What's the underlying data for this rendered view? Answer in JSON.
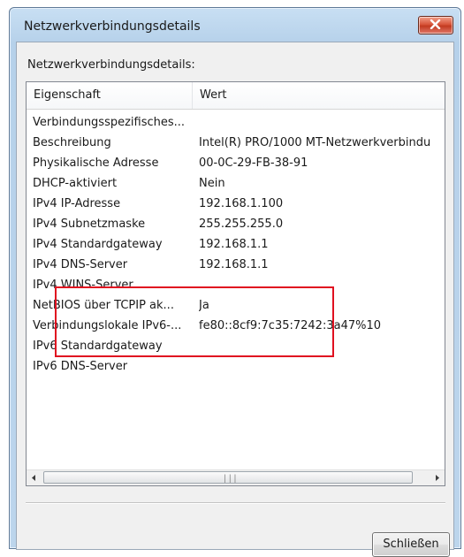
{
  "window": {
    "title": "Netzwerkverbindungsdetails"
  },
  "group_label": "Netzwerkverbindungsdetails:",
  "columns": {
    "property": "Eigenschaft",
    "value": "Wert"
  },
  "rows": [
    {
      "property": "Verbindungsspezifisches...",
      "value": ""
    },
    {
      "property": "Beschreibung",
      "value": "Intel(R) PRO/1000 MT-Netzwerkverbindu"
    },
    {
      "property": "Physikalische Adresse",
      "value": "00-0C-29-FB-38-91"
    },
    {
      "property": "DHCP-aktiviert",
      "value": "Nein"
    },
    {
      "property": "IPv4 IP-Adresse",
      "value": "192.168.1.100"
    },
    {
      "property": "IPv4 Subnetzmaske",
      "value": "255.255.255.0"
    },
    {
      "property": "IPv4 Standardgateway",
      "value": "192.168.1.1"
    },
    {
      "property": "IPv4 DNS-Server",
      "value": "192.168.1.1"
    },
    {
      "property": "IPv4 WINS-Server",
      "value": ""
    },
    {
      "property": "NetBIOS über TCPIP ak...",
      "value": "Ja"
    },
    {
      "property": "Verbindungslokale IPv6-...",
      "value": "fe80::8cf9:7c35:7242:3a47%10"
    },
    {
      "property": "IPv6 Standardgateway",
      "value": ""
    },
    {
      "property": "IPv6 DNS-Server",
      "value": ""
    }
  ],
  "highlighted_rows": [
    "IPv4 Subnetzmaske",
    "IPv4 Standardgateway",
    "IPv4 DNS-Server"
  ],
  "highlight_color": "#e01020",
  "buttons": {
    "close": "Schließen"
  },
  "icons": {
    "title_close": "close-icon",
    "scroll_left": "arrow-left-icon",
    "scroll_right": "arrow-right-icon",
    "scroll_grip": "grip-icon"
  }
}
